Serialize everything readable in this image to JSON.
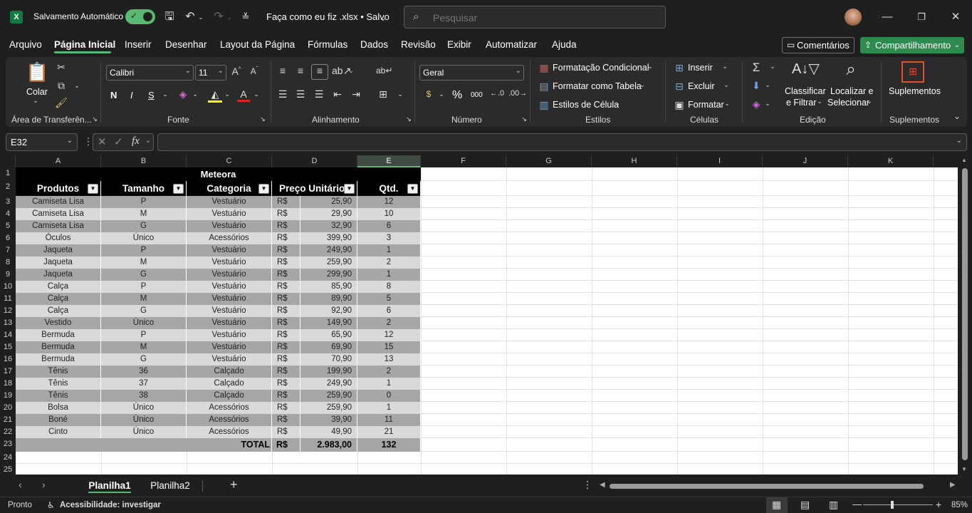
{
  "titlebar": {
    "autosave_label": "Salvamento Automático",
    "filename": "Faça como eu fiz .xlsx • Salvo",
    "search_placeholder": "Pesquisar"
  },
  "menu": {
    "items": [
      "Arquivo",
      "Página Inicial",
      "Inserir",
      "Desenhar",
      "Layout da Página",
      "Fórmulas",
      "Dados",
      "Revisão",
      "Exibir",
      "Automatizar",
      "Ajuda"
    ],
    "active": "Página Inicial",
    "comments": "Comentários",
    "share": "Compartilhamento"
  },
  "ribbon": {
    "clipboard": {
      "paste": "Colar",
      "label": "Área de Transferên..."
    },
    "font": {
      "name": "Calibri",
      "size": "11",
      "label": "Fonte",
      "bold": "N",
      "italic": "I",
      "underline": "S"
    },
    "alignment": {
      "label": "Alinhamento"
    },
    "number": {
      "format": "Geral",
      "label": "Número",
      "currency": "$",
      "percent": "%",
      "thousands": "000"
    },
    "styles": {
      "conditional": "Formatação Condicional",
      "as_table": "Formatar como Tabela",
      "cell_styles": "Estilos de Célula",
      "label": "Estilos"
    },
    "cells": {
      "insert": "Inserir",
      "delete": "Excluir",
      "format": "Formatar",
      "label": "Células"
    },
    "editing": {
      "sort_1": "Classificar",
      "sort_2": "e Filtrar",
      "find_1": "Localizar e",
      "find_2": "Selecionar",
      "label": "Edição"
    },
    "addins": {
      "button": "Suplementos",
      "label": "Suplementos"
    }
  },
  "formula_bar": {
    "name_box": "E32",
    "fx": "fx",
    "formula": ""
  },
  "columns": [
    "A",
    "B",
    "C",
    "D",
    "E",
    "F",
    "G",
    "H",
    "I",
    "J",
    "K"
  ],
  "selected_column": "E",
  "rows": [
    "1",
    "2",
    "3",
    "4",
    "5",
    "6",
    "7",
    "8",
    "9",
    "10",
    "11",
    "12",
    "13",
    "14",
    "15",
    "16",
    "17",
    "18",
    "19",
    "20",
    "21",
    "22",
    "23",
    "24",
    "25"
  ],
  "table": {
    "title": "Meteora",
    "headers": [
      "Produtos",
      "Tamanho",
      "Categoria",
      "Preço Unitário",
      "Qtd."
    ],
    "currency": "R$",
    "data": [
      [
        "Camiseta Lisa",
        "P",
        "Vestuário",
        "25,90",
        "12"
      ],
      [
        "Camiseta Lisa",
        "M",
        "Vestuário",
        "29,90",
        "10"
      ],
      [
        "Camiseta Lisa",
        "G",
        "Vestuário",
        "32,90",
        "6"
      ],
      [
        "Óculos",
        "Único",
        "Acessórios",
        "399,90",
        "3"
      ],
      [
        "Jaqueta",
        "P",
        "Vestuário",
        "249,90",
        "1"
      ],
      [
        "Jaqueta",
        "M",
        "Vestuário",
        "259,90",
        "2"
      ],
      [
        "Jaqueta",
        "G",
        "Vestuário",
        "299,90",
        "1"
      ],
      [
        "Calça",
        "P",
        "Vestuário",
        "85,90",
        "8"
      ],
      [
        "Calça",
        "M",
        "Vestuário",
        "89,90",
        "5"
      ],
      [
        "Calça",
        "G",
        "Vestuário",
        "92,90",
        "6"
      ],
      [
        "Vestido",
        "Único",
        "Vestuário",
        "149,90",
        "2"
      ],
      [
        "Bermuda",
        "P",
        "Vestuário",
        "65,90",
        "12"
      ],
      [
        "Bermuda",
        "M",
        "Vestuário",
        "69,90",
        "15"
      ],
      [
        "Bermuda",
        "G",
        "Vestuário",
        "70,90",
        "13"
      ],
      [
        "Tênis",
        "36",
        "Calçado",
        "199,90",
        "2"
      ],
      [
        "Tênis",
        "37",
        "Calçado",
        "249,90",
        "1"
      ],
      [
        "Tênis",
        "38",
        "Calçado",
        "259,90",
        "0"
      ],
      [
        "Bolsa",
        "Único",
        "Acessórios",
        "259,90",
        "1"
      ],
      [
        "Boné",
        "Único",
        "Acessórios",
        "39,90",
        "11"
      ],
      [
        "Cinto",
        "Único",
        "Acessórios",
        "49,90",
        "21"
      ]
    ],
    "total_label": "TOTAL",
    "total_value": "2.983,00",
    "total_qty": "132"
  },
  "sheets": {
    "tabs": [
      "Planilha1",
      "Planilha2"
    ],
    "active": "Planilha1"
  },
  "status": {
    "ready": "Pronto",
    "accessibility": "Acessibilidade: investigar",
    "zoom": "85%"
  },
  "colors": {
    "accent": "#57b973",
    "row_dark": "#a6a6a6",
    "row_light": "#d9d9d9",
    "header_bg": "#000000"
  }
}
